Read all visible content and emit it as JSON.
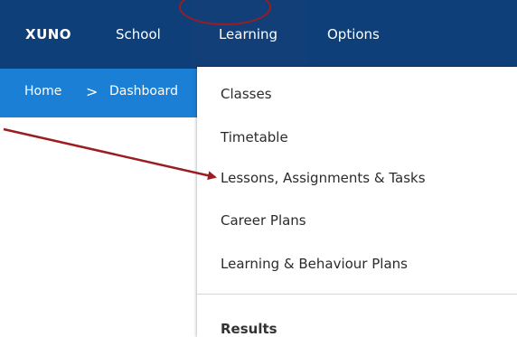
{
  "nav": {
    "brand": "XUNO",
    "items": [
      "School",
      "Learning",
      "Options"
    ]
  },
  "breadcrumb": {
    "home": "Home",
    "separator": ">",
    "current": "Dashboard"
  },
  "dropdown": {
    "items": [
      "Classes",
      "Timetable",
      "Lessons, Assignments & Tasks",
      "Career Plans",
      "Learning & Behaviour Plans",
      "Results"
    ]
  },
  "colors": {
    "navbar": "#0f3f78",
    "breadcrumb_bar": "#1b7fd6",
    "annotation": "#9b1d22"
  },
  "annotation": {
    "arrow_icon": "arrow-annotation-icon",
    "circle": "circle-highlight"
  }
}
